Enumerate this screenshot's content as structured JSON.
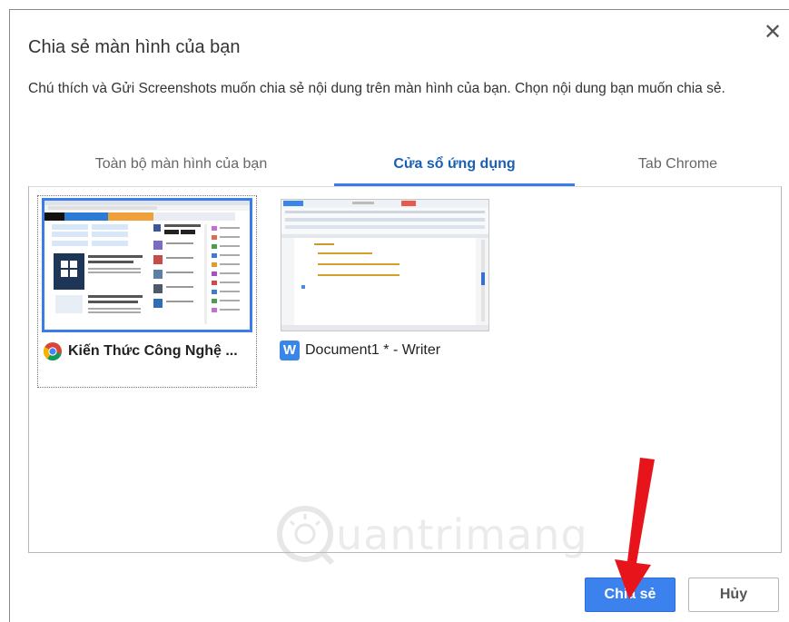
{
  "dialog": {
    "title": "Chia sẻ màn hình của bạn",
    "description": "Chú thích và Gửi Screenshots muốn chia sẻ nội dung trên màn hình của bạn. Chọn nội dung bạn muốn chia sẻ.",
    "close_icon": "close-icon"
  },
  "tabs": [
    {
      "label": "Toàn bộ màn hình của bạn",
      "active": false
    },
    {
      "label": "Cửa sổ ứng dụng",
      "active": true
    },
    {
      "label": "Tab Chrome",
      "active": false
    }
  ],
  "windows": [
    {
      "label": "Kiến Thức Công Nghệ ...",
      "icon": "chrome-icon",
      "selected": true
    },
    {
      "label": "Document1 * - Writer",
      "icon": "writer-icon",
      "selected": false
    }
  ],
  "buttons": {
    "share": "Chia sẻ",
    "cancel": "Hủy"
  },
  "watermark": "uantrimang",
  "colors": {
    "accent": "#3b7de8",
    "share_button": "#3b82ee",
    "arrow": "#e8141c"
  }
}
